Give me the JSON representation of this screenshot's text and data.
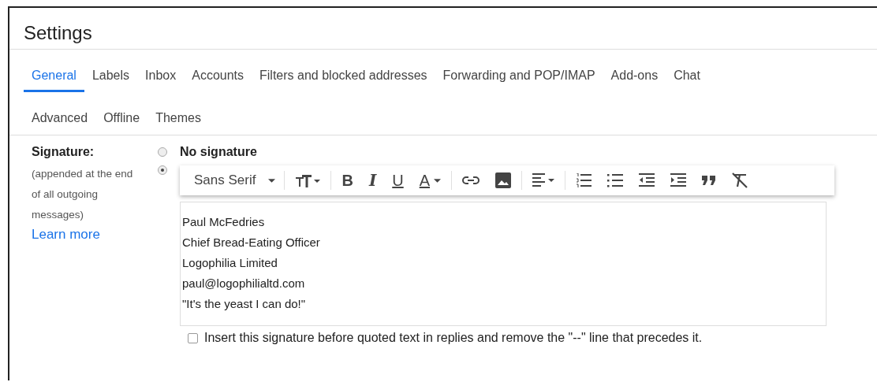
{
  "title": "Settings",
  "tabs": [
    [
      {
        "label": "General",
        "selected": true
      },
      {
        "label": "Labels",
        "selected": false
      },
      {
        "label": "Inbox",
        "selected": false
      },
      {
        "label": "Accounts",
        "selected": false
      },
      {
        "label": "Filters and blocked addresses",
        "selected": false
      },
      {
        "label": "Forwarding and POP/IMAP",
        "selected": false
      },
      {
        "label": "Add-ons",
        "selected": false
      },
      {
        "label": "Chat",
        "selected": false
      }
    ],
    [
      {
        "label": "Advanced",
        "selected": false
      },
      {
        "label": "Offline",
        "selected": false
      },
      {
        "label": "Themes",
        "selected": false
      }
    ]
  ],
  "signature": {
    "label": "Signature:",
    "description": "(appended at the end of all outgoing messages)",
    "learn_more": "Learn more",
    "options": [
      {
        "label": "No signature",
        "selected": false
      },
      {
        "selected": true
      }
    ],
    "toolbar": [
      {
        "kind": "font",
        "label": "Sans Serif"
      },
      {
        "kind": "size"
      },
      {
        "kind": "bold",
        "label": "B"
      },
      {
        "kind": "italic",
        "label": "I"
      },
      {
        "kind": "underline",
        "label": "U"
      },
      {
        "kind": "color",
        "label": "A"
      },
      {
        "kind": "link"
      },
      {
        "kind": "image"
      },
      {
        "kind": "align"
      },
      {
        "kind": "numbered"
      },
      {
        "kind": "bulleted"
      },
      {
        "kind": "outdent"
      },
      {
        "kind": "indent"
      },
      {
        "kind": "quote"
      },
      {
        "kind": "clear"
      }
    ],
    "lines": [
      "Paul McFedries",
      "Chief Bread-Eating Officer",
      "Logophilia Limited",
      "paul@logophilialtd.com",
      "\"It's the yeast I can do!\""
    ],
    "insert_before": {
      "label": "Insert this signature before quoted text in replies and remove the \"--\" line that precedes it.",
      "checked": false
    }
  }
}
